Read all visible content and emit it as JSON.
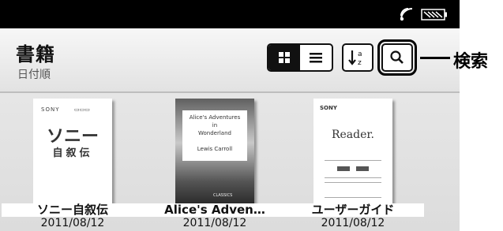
{
  "header": {
    "title": "書籍",
    "subtitle": "日付順"
  },
  "toolbar": {
    "grid_view_icon": "grid-icon",
    "list_view_icon": "list-icon",
    "sort_icon": "sort-az-icon",
    "sort_label": "a z",
    "search_icon": "search-icon"
  },
  "callout": {
    "label": "検索"
  },
  "books": [
    {
      "title": "ソニー自叙伝",
      "date": "2011/08/12",
      "cover": {
        "brand": "SONY",
        "big": "ソニー",
        "small": "自叙伝"
      }
    },
    {
      "title": "Alice's Adven…",
      "date": "2011/08/12",
      "cover": {
        "line1": "Alice's Adventures",
        "line2": "in",
        "line3": "Wonderland",
        "author": "Lewis Carroll",
        "publisher": "CLASSICS"
      }
    },
    {
      "title": "ユーザーガイド",
      "date": "2011/08/12",
      "cover": {
        "brand": "SONY",
        "logo": "Reader."
      }
    }
  ],
  "colors": {
    "status_bar": "#000000",
    "header_bg": "#f0f0f0",
    "grid_bg": "#e4e4e4",
    "accent": "#111111"
  }
}
